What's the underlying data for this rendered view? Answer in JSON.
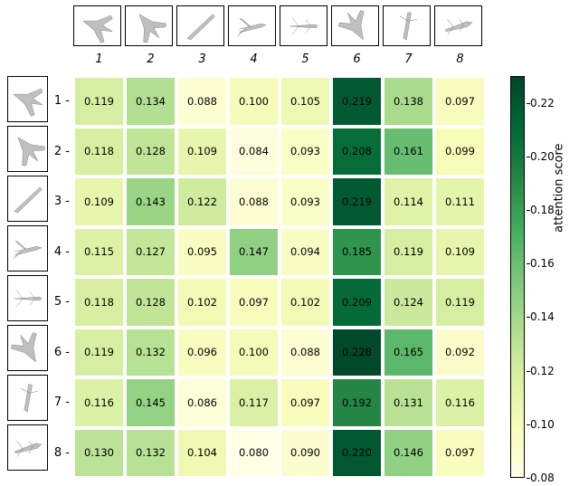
{
  "chart_data": {
    "type": "heatmap",
    "title": "",
    "xlabel": "",
    "ylabel": "",
    "colorbar_label": "attention score",
    "zmin": 0.08,
    "zmax": 0.23,
    "row_labels": [
      "1 -",
      "2 -",
      "3 -",
      "4 -",
      "5 -",
      "6 -",
      "7 -",
      "8 -"
    ],
    "col_labels": [
      "1",
      "2",
      "3",
      "4",
      "5",
      "6",
      "7",
      "8"
    ],
    "values": [
      [
        0.119,
        0.134,
        0.088,
        0.1,
        0.105,
        0.219,
        0.138,
        0.097
      ],
      [
        0.118,
        0.128,
        0.109,
        0.084,
        0.093,
        0.208,
        0.161,
        0.099
      ],
      [
        0.109,
        0.143,
        0.122,
        0.088,
        0.093,
        0.219,
        0.114,
        0.111
      ],
      [
        0.115,
        0.127,
        0.095,
        0.147,
        0.094,
        0.185,
        0.119,
        0.109
      ],
      [
        0.118,
        0.128,
        0.102,
        0.097,
        0.102,
        0.209,
        0.124,
        0.119
      ],
      [
        0.119,
        0.132,
        0.096,
        0.1,
        0.088,
        0.228,
        0.165,
        0.092
      ],
      [
        0.116,
        0.145,
        0.086,
        0.117,
        0.097,
        0.192,
        0.131,
        0.116
      ],
      [
        0.13,
        0.132,
        0.104,
        0.08,
        0.09,
        0.22,
        0.146,
        0.097
      ]
    ],
    "colorbar_ticks": [
      0.08,
      0.1,
      0.12,
      0.14,
      0.16,
      0.18,
      0.2,
      0.22
    ],
    "rows": 8,
    "cols": 8
  },
  "colorbar": {
    "label": "attention score",
    "tick_labels": [
      "0.08",
      "0.10",
      "0.12",
      "0.14",
      "0.16",
      "0.18",
      "0.20",
      "0.22"
    ]
  },
  "icons": {
    "col": [
      "airplane-view-1",
      "airplane-view-2",
      "airplane-view-3",
      "airplane-view-4",
      "airplane-view-5",
      "airplane-view-6",
      "airplane-view-7",
      "airplane-view-8"
    ],
    "row": [
      "airplane-view-1",
      "airplane-view-2",
      "airplane-view-3",
      "airplane-view-4",
      "airplane-view-5",
      "airplane-view-6",
      "airplane-view-7",
      "airplane-view-8"
    ]
  }
}
